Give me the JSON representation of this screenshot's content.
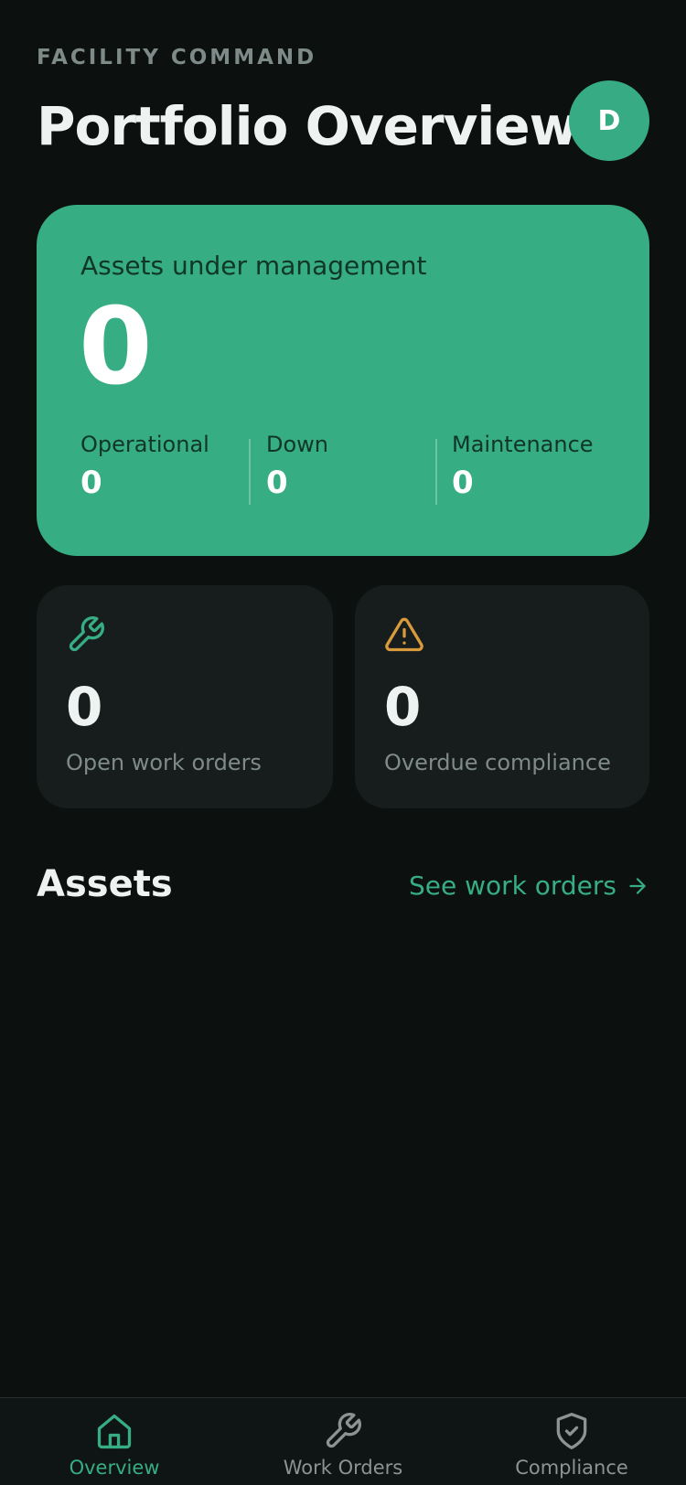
{
  "header": {
    "eyebrow": "FACILITY COMMAND",
    "title": "Portfolio Overview",
    "avatar_initial": "D"
  },
  "hero": {
    "label": "Assets under management",
    "value": "0",
    "stats": [
      {
        "label": "Operational",
        "value": "0"
      },
      {
        "label": "Down",
        "value": "0"
      },
      {
        "label": "Maintenance",
        "value": "0"
      }
    ]
  },
  "cards": [
    {
      "icon": "wrench-icon",
      "value": "0",
      "label": "Open work orders",
      "color": "#37ad84"
    },
    {
      "icon": "warning-triangle-icon",
      "value": "0",
      "label": "Overdue compliance",
      "color": "#d89a3a"
    }
  ],
  "assets_section": {
    "title": "Assets",
    "link_label": "See work orders"
  },
  "bottom_nav": {
    "items": [
      {
        "label": "Overview",
        "icon": "home-icon",
        "active": true
      },
      {
        "label": "Work Orders",
        "icon": "wrench-icon",
        "active": false
      },
      {
        "label": "Compliance",
        "icon": "shield-check-icon",
        "active": false
      }
    ]
  },
  "colors": {
    "accent": "#37ad84",
    "warning": "#d89a3a",
    "background": "#0c1110",
    "card": "#161d1c"
  }
}
